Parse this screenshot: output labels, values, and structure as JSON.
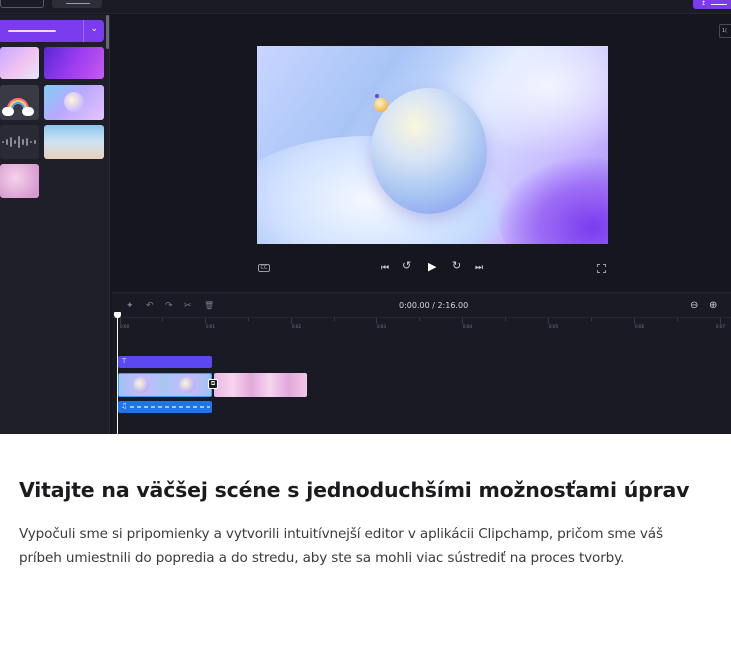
{
  "editor": {
    "timecode": "0:00.00 / 2:16.00",
    "zoom_level": "1(",
    "ruler_ticks": [
      "0:00",
      "0:01",
      "0:02",
      "0:03",
      "0:04",
      "0:05",
      "0:06",
      "0:07"
    ],
    "accent_color": "#7b3cf0",
    "title_track_color": "#5b48f0",
    "audio_track_color": "#1e74e8",
    "icons": {
      "captions": "CC",
      "skip_back": "⏮",
      "rewind_5": "↺",
      "play": "▶",
      "forward_5": "↻",
      "skip_forward": "⏭",
      "magic": "✦",
      "undo": "↶",
      "redo": "↷",
      "cut": "✂",
      "delete": "🗑",
      "zoom_out": "⊖",
      "zoom_in": "⊕",
      "title_track": "T",
      "audio_note": "♫",
      "transition": "⧉",
      "dropdown_chevron": "⌄",
      "export": "↥"
    }
  },
  "content": {
    "headline": "Vitajte na väčšej scéne s jednoduchšími možnosťami úprav",
    "body": "Vypočuli sme si pripomienky a vytvorili intuitívnejší editor v aplikácii Clipchamp, pričom sme váš príbeh umiestnili do popredia a do stredu, aby ste sa mohli viac sústrediť na proces tvorby."
  }
}
